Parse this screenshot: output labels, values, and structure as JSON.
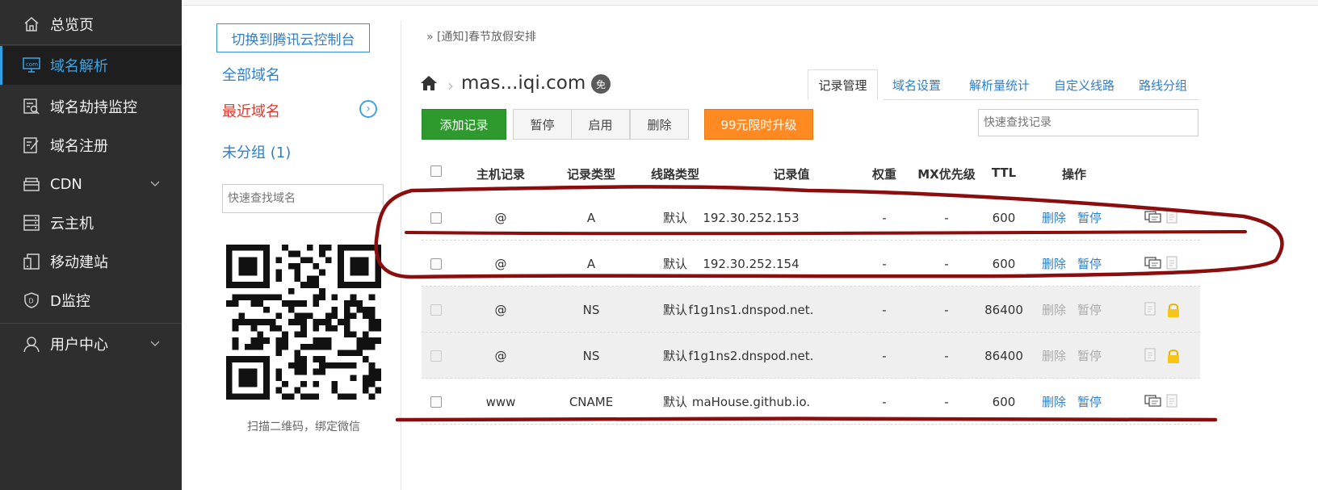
{
  "sidebar": {
    "items": [
      {
        "label": "总览页",
        "icon": "home-icon"
      },
      {
        "label": "域名解析",
        "icon": "dns-icon",
        "active": true
      },
      {
        "label": "域名劫持监控",
        "icon": "monitor-search-icon"
      },
      {
        "label": "域名注册",
        "icon": "register-icon"
      },
      {
        "label": "CDN",
        "icon": "cdn-icon",
        "expandable": true
      },
      {
        "label": "云主机",
        "icon": "server-icon"
      },
      {
        "label": "移动建站",
        "icon": "mobile-site-icon"
      },
      {
        "label": "D监控",
        "icon": "shield-icon"
      },
      {
        "label": "用户中心",
        "icon": "user-icon",
        "expandable": true
      }
    ]
  },
  "left_panel": {
    "switch_button": "切换到腾讯云控制台",
    "groups": [
      "全部域名",
      "最近域名",
      "未分组 (1)"
    ],
    "search_placeholder": "快速查找域名",
    "qr_caption": "扫描二维码，绑定微信"
  },
  "main": {
    "notice": "» [通知]春节放假安排",
    "domain": "mas...iqi.com",
    "free_badge": "免",
    "tabs": [
      "记录管理",
      "域名设置",
      "解析量统计",
      "自定义线路",
      "路线分组"
    ],
    "active_tab": 0,
    "toolbar": {
      "add": "添加记录",
      "pause": "暂停",
      "enable": "启用",
      "delete": "删除",
      "upgrade": "99元限时升级",
      "search_placeholder": "快速查找记录"
    },
    "table": {
      "headers": [
        "主机记录",
        "记录类型",
        "线路类型",
        "记录值",
        "权重",
        "MX优先级",
        "TTL",
        "操作"
      ],
      "rows": [
        {
          "host": "@",
          "type": "A",
          "line": "默认",
          "value": "192.30.252.153",
          "weight": "-",
          "mx": "-",
          "ttl": "600",
          "delete": "删除",
          "pause": "暂停",
          "locked": false
        },
        {
          "host": "@",
          "type": "A",
          "line": "默认",
          "value": "192.30.252.154",
          "weight": "-",
          "mx": "-",
          "ttl": "600",
          "delete": "删除",
          "pause": "暂停",
          "locked": false
        },
        {
          "host": "@",
          "type": "NS",
          "line": "默认",
          "value": "f1g1ns1.dnspod.net.",
          "weight": "-",
          "mx": "-",
          "ttl": "86400",
          "delete": "删除",
          "pause": "暂停",
          "locked": true
        },
        {
          "host": "@",
          "type": "NS",
          "line": "默认",
          "value": "f1g1ns2.dnspod.net.",
          "weight": "-",
          "mx": "-",
          "ttl": "86400",
          "delete": "删除",
          "pause": "暂停",
          "locked": true
        },
        {
          "host": "www",
          "type": "CNAME",
          "line": "默认",
          "value": "maHouse.github.io.",
          "weight": "-",
          "mx": "-",
          "ttl": "600",
          "delete": "删除",
          "pause": "暂停",
          "locked": false
        }
      ]
    }
  },
  "colors": {
    "sidebar_bg": "#2e2e2e",
    "accent_blue": "#2f7fc9",
    "add_green": "#2e9a2e",
    "upgrade_orange": "#ff8a22",
    "recent_red": "#e0382c",
    "annotation_red": "#8b0d0d"
  }
}
